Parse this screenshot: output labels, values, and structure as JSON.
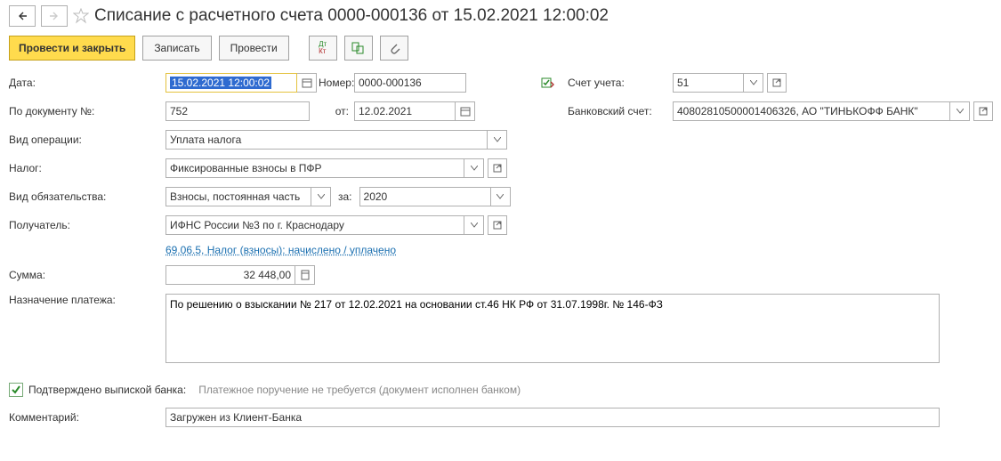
{
  "header": {
    "title": "Списание с расчетного счета 0000-000136 от 15.02.2021 12:00:02"
  },
  "toolbar": {
    "post_close": "Провести и закрыть",
    "save": "Записать",
    "post": "Провести"
  },
  "labels": {
    "date": "Дата:",
    "number": "Номер:",
    "account": "Счет учета:",
    "by_doc": "По документу №:",
    "from": "от:",
    "bank_account": "Банковский счет:",
    "op_type": "Вид операции:",
    "tax": "Налог:",
    "obligation": "Вид обязательства:",
    "for": "за:",
    "recipient": "Получатель:",
    "sum": "Сумма:",
    "purpose": "Назначение платежа:",
    "comment": "Комментарий:",
    "confirmed": "Подтверждено выпиской банка:",
    "hint": "Платежное поручение не требуется (документ исполнен банком)"
  },
  "values": {
    "date": "15.02.2021 12:00:02",
    "number": "0000-000136",
    "account": "51",
    "by_doc": "752",
    "from": "12.02.2021",
    "bank_account": "40802810500001406326, АО \"ТИНЬКОФФ БАНК\"",
    "op_type": "Уплата налога",
    "tax": "Фиксированные взносы в ПФР",
    "obligation": "Взносы, постоянная часть",
    "year": "2020",
    "recipient": "ИФНС России №3 по г. Краснодару",
    "link": "69.06.5, Налог (взносы): начислено / уплачено",
    "sum": "32 448,00",
    "purpose": "По решению о взыскании № 217 от 12.02.2021 на основании ст.46 НК РФ от 31.07.1998г. № 146-ФЗ",
    "comment": "Загружен из Клиент-Банка"
  }
}
